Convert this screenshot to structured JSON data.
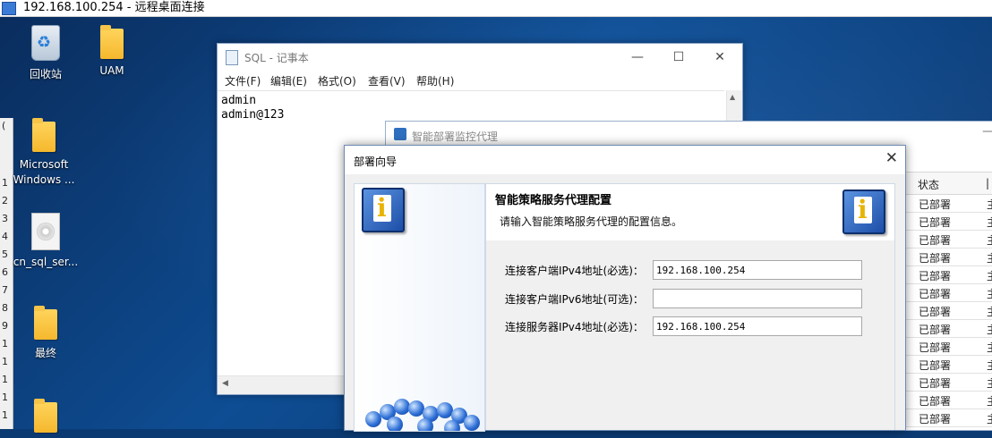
{
  "rdp": {
    "title": "192.168.100.254 - 远程桌面连接"
  },
  "left_window": {
    "row_digits": [
      "1",
      "2",
      "3",
      "4",
      "5",
      "6",
      "7",
      "8",
      "9",
      "1",
      "1",
      "1",
      "1",
      "1",
      "1",
      "1",
      "1"
    ]
  },
  "desktop_icons": [
    {
      "label": "回收站",
      "icon": "recycle-bin-icon"
    },
    {
      "label": "UAM",
      "icon": "folder-icon"
    },
    {
      "label": "Microsoft Windows ...",
      "icon": "folder-icon"
    },
    {
      "label": "cn_sql_ser...",
      "icon": "disc-image-icon"
    },
    {
      "label": "最终",
      "icon": "folder-icon"
    }
  ],
  "notepad": {
    "title": "SQL - 记事本",
    "menu": [
      "文件(F)",
      "编辑(E)",
      "格式(O)",
      "查看(V)",
      "帮助(H)"
    ],
    "lines": [
      "admin",
      "admin@123"
    ]
  },
  "agent": {
    "title": "智能部署监控代理",
    "grid": {
      "header": "状态",
      "rows": [
        "已部署",
        "已部署",
        "已部署",
        "已部署",
        "已部署",
        "已部署",
        "已部署",
        "已部署",
        "已部署",
        "已部署",
        "已部署",
        "已部署",
        "已部署"
      ],
      "col2_char": "主"
    }
  },
  "wizard": {
    "title": "部署向导",
    "heading": "智能策略服务代理配置",
    "subheading": "请输入智能策略服务代理的配置信息。",
    "fields": [
      {
        "label": "连接客户端IPv4地址(必选)：",
        "value": "192.168.100.254"
      },
      {
        "label": "连接客户端IPv6地址(可选)：",
        "value": ""
      },
      {
        "label": "连接服务器IPv4地址(必选)：",
        "value": "192.168.100.254"
      }
    ]
  },
  "colors": {
    "desktop_blue": "#0e4d93",
    "window_border": "#6d8bb5"
  }
}
